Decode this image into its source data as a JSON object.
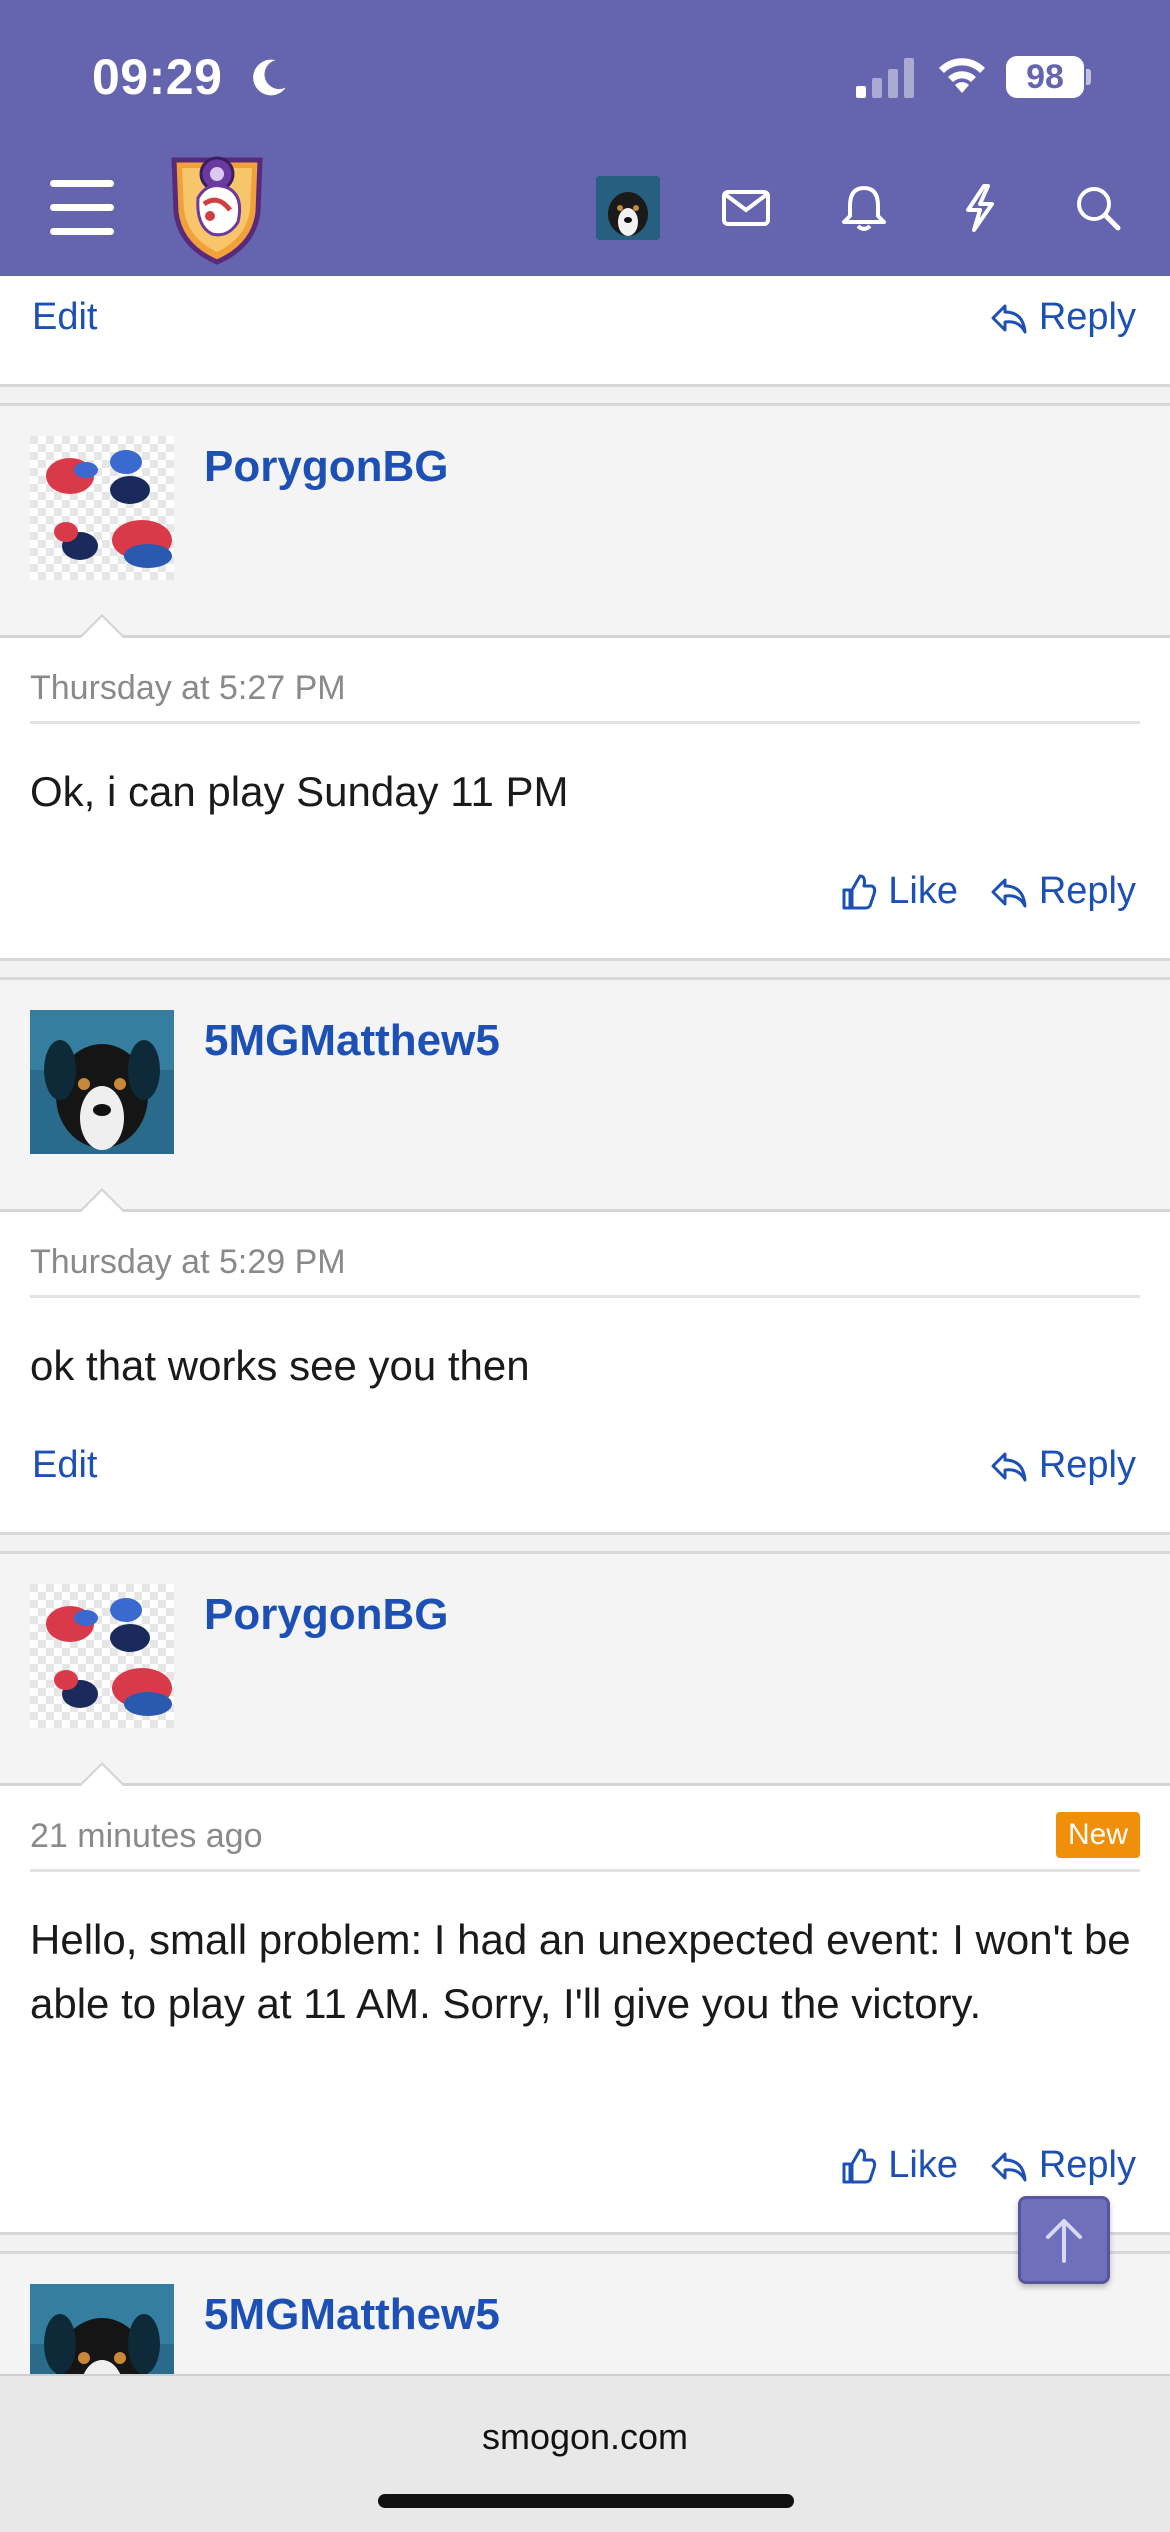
{
  "status_bar": {
    "time": "09:29",
    "battery": "98"
  },
  "header": {
    "icons": [
      "menu-icon",
      "site-logo",
      "account-avatar",
      "inbox-icon",
      "bell-icon",
      "lightning-icon",
      "search-icon"
    ],
    "brand_color": "#6564af"
  },
  "top_actions": {
    "edit": "Edit",
    "reply": "Reply"
  },
  "posts": [
    {
      "username": "PorygonBG",
      "time": "Thursday at 5:27 PM",
      "body": "Ok, i can play Sunday 11 PM",
      "like": "Like",
      "reply": "Reply"
    },
    {
      "username": "5MGMatthew5",
      "time": "Thursday at 5:29 PM",
      "body": "ok that works see you then",
      "edit": "Edit",
      "reply": "Reply"
    },
    {
      "username": "PorygonBG",
      "time": "21 minutes ago",
      "badge": "New",
      "body": "Hello, small problem: I had an unexpected event: I won't be able to play at 11 AM. Sorry, I'll give you the victory.",
      "like": "Like",
      "reply": "Reply"
    },
    {
      "username": "5MGMatthew5"
    }
  ],
  "browser": {
    "url": "smogon.com"
  },
  "colors": {
    "link": "#1d50b4",
    "new_badge": "#f0900a"
  }
}
